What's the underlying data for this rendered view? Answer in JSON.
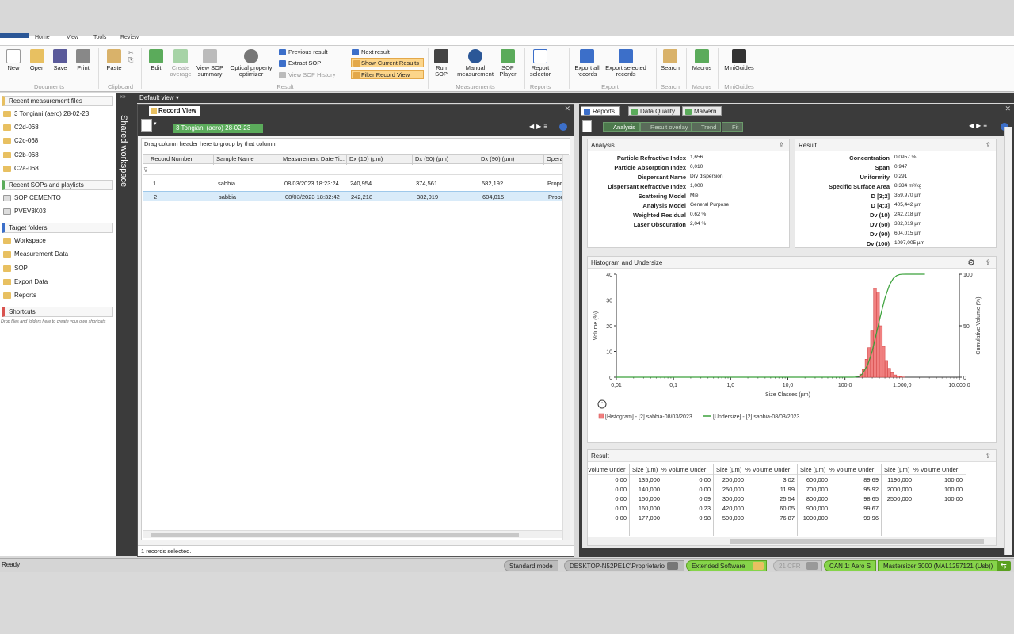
{
  "menu": [
    "Home",
    "View",
    "Tools",
    "Review"
  ],
  "ribbon": {
    "documents": {
      "label": "Documents",
      "buttons": [
        "New",
        "Open",
        "Save",
        "Print"
      ]
    },
    "clipboard": {
      "label": "Clipboard",
      "buttons": [
        "Paste"
      ]
    },
    "result": {
      "label": "Result",
      "edit": "Edit",
      "create_average": "Create average",
      "view_sop_summary": "View SOP summary",
      "optical_property": "Optical property optimizer",
      "previous_result": "Previous result",
      "extract_sop": "Extract SOP",
      "view_sop_history": "View SOP History",
      "next_result": "Next result",
      "show_current": "Show Current Results",
      "filter_record": "Filter Record View"
    },
    "measurements": {
      "label": "Measurements",
      "run_sop": "Run SOP",
      "manual": "Manual measurement",
      "sop_player": "SOP Player"
    },
    "reports": {
      "label": "Reports",
      "report_selector": "Report selector"
    },
    "export": {
      "label": "Export",
      "export_all": "Export all records",
      "export_selected": "Export selected records"
    },
    "search": {
      "label": "Search",
      "search": "Search"
    },
    "macros": {
      "label": "Macros",
      "macros": "Macros"
    },
    "miniguides": {
      "label": "MiniGuides",
      "miniguides": "MiniGuides"
    }
  },
  "left": {
    "recent_files_header": "Recent measurement files",
    "recent_files": [
      "3 Tongiani (aero) 28-02-23",
      "C2d-068",
      "C2c-068",
      "C2b-068",
      "C2a-068"
    ],
    "recent_sops_header": "Recent SOPs and playlists",
    "recent_sops": [
      "SOP CEMENTO",
      "PVEV3K03"
    ],
    "target_header": "Target folders",
    "target_folders": [
      "Workspace",
      "Measurement Data",
      "SOP",
      "Export Data",
      "Reports"
    ],
    "shortcuts_header": "Shortcuts",
    "shortcuts_hint": "Drop files and folders here to create your own shortcuts"
  },
  "shared_workspace": "Shared workspace",
  "default_view": "Default view",
  "record_view": {
    "tab": "Record View",
    "file": "3 Tongiani (aero) 28-02-23",
    "group_hint": "Drag column header here to group by that column",
    "columns": [
      "Record Number",
      "Sample Name",
      "Measurement Date Ti...",
      "Dx (10) (µm)",
      "Dx (50) (µm)",
      "Dx (90) (µm)",
      "Operato"
    ],
    "rows": [
      [
        "1",
        "sabbia",
        "08/03/2023 18:23:24",
        "240,954",
        "374,561",
        "582,192",
        "Proprie"
      ],
      [
        "2",
        "sabbia",
        "08/03/2023 18:32:42",
        "242,218",
        "382,019",
        "604,015",
        "Proprie"
      ]
    ],
    "footer": "1 records selected."
  },
  "right": {
    "tabs": [
      "Reports",
      "Data Quality",
      "Malvern"
    ],
    "subtabs": [
      "Analysis",
      "Result overlay",
      "Trend",
      "Fit"
    ],
    "analysis": {
      "title": "Analysis",
      "items": [
        {
          "k": "Particle Refractive Index",
          "v": "1,656"
        },
        {
          "k": "Particle Absorption Index",
          "v": "0,010"
        },
        {
          "k": "Dispersant Name",
          "v": "Dry dispersion"
        },
        {
          "k": "Dispersant Refractive Index",
          "v": "1,000"
        },
        {
          "k": "Scattering Model",
          "v": "Mie"
        },
        {
          "k": "Analysis Model",
          "v": "General Purpose"
        },
        {
          "k": "Weighted Residual",
          "v": "0,62 %"
        },
        {
          "k": "Laser Obscuration",
          "v": "2,04 %"
        }
      ]
    },
    "result": {
      "title": "Result",
      "items": [
        {
          "k": "Concentration",
          "v": "0,0957 %"
        },
        {
          "k": "Span",
          "v": "0,947"
        },
        {
          "k": "Uniformity",
          "v": "0,291"
        },
        {
          "k": "Specific Surface Area",
          "v": "8,334 m²/kg"
        },
        {
          "k": "D [3;2]",
          "v": "359,970 µm"
        },
        {
          "k": "D [4;3]",
          "v": "405,442 µm"
        },
        {
          "k": "Dv (10)",
          "v": "242,218 µm"
        },
        {
          "k": "Dv (50)",
          "v": "382,019 µm"
        },
        {
          "k": "Dv (90)",
          "v": "604,015 µm"
        },
        {
          "k": "Dv (100)",
          "v": "1097,005 µm"
        }
      ]
    },
    "histogram_title": "Histogram and Undersize",
    "result_table": {
      "title": "Result",
      "groups": [
        {
          "size_header": "",
          "vol_header": "Volume Under",
          "sizes": [
            "",
            "",
            "",
            "",
            ""
          ],
          "vols": [
            "0,00",
            "0,00",
            "0,00",
            "0,00",
            "0,00"
          ]
        },
        {
          "size_header": "Size (µm)",
          "vol_header": "% Volume Under",
          "sizes": [
            "135,000",
            "140,000",
            "150,000",
            "160,000",
            "177,000"
          ],
          "vols": [
            "0,00",
            "0,00",
            "0,09",
            "0,23",
            "0,98"
          ]
        },
        {
          "size_header": "Size (µm)",
          "vol_header": "% Volume Under",
          "sizes": [
            "200,000",
            "250,000",
            "300,000",
            "420,000",
            "500,000"
          ],
          "vols": [
            "3,02",
            "11,99",
            "25,54",
            "60,05",
            "76,87"
          ]
        },
        {
          "size_header": "Size (µm)",
          "vol_header": "% Volume Under",
          "sizes": [
            "600,000",
            "700,000",
            "800,000",
            "900,000",
            "1000,000"
          ],
          "vols": [
            "89,69",
            "95,92",
            "98,65",
            "99,67",
            "99,96"
          ]
        },
        {
          "size_header": "Size (µm)",
          "vol_header": "% Volume Under",
          "sizes": [
            "1190,000",
            "2000,000",
            "2500,000",
            "",
            ""
          ],
          "vols": [
            "100,00",
            "100,00",
            "100,00",
            "",
            ""
          ]
        }
      ]
    }
  },
  "chart_data": {
    "type": "bar",
    "xlabel": "Size Classes (µm)",
    "ylabel": "Volume (%)",
    "y2label": "Cumulative Volume (%)",
    "xscale": "log",
    "xlim": [
      0.01,
      10000
    ],
    "ylim": [
      0,
      40
    ],
    "y2lim": [
      0,
      100
    ],
    "xticks": [
      "0,01",
      "0,1",
      "1,0",
      "10,0",
      "100,0",
      "1.000,0",
      "10.000,0"
    ],
    "yticks": [
      "0",
      "10",
      "20",
      "30",
      "40"
    ],
    "y2ticks": [
      "0",
      "50",
      "100"
    ],
    "series": [
      {
        "name": "[Histogram] - [2] sabbia-08/03/2023",
        "kind": "bar",
        "color": "#f08080",
        "x_edges": [
          180,
          200,
          225,
          250,
          280,
          315,
          355,
          400,
          450,
          500,
          560,
          630,
          710,
          800,
          900,
          1000,
          1100
        ],
        "values": [
          1.2,
          3.0,
          7.0,
          11.5,
          18.0,
          34.5,
          33.0,
          20.0,
          12.0,
          6.5,
          3.5,
          1.8,
          0.9,
          0.4,
          0.2,
          0.1
        ]
      },
      {
        "name": "[Undersize] - [2] sabbia-08/03/2023",
        "kind": "line",
        "color": "#3aa13a",
        "x": [
          0.01,
          100,
          135,
          150,
          177,
          200,
          250,
          300,
          420,
          500,
          600,
          700,
          800,
          900,
          1000,
          1190,
          2500
        ],
        "y": [
          0,
          0,
          0,
          0.09,
          0.98,
          3.02,
          11.99,
          25.54,
          60.05,
          76.87,
          89.69,
          95.92,
          98.65,
          99.67,
          99.96,
          100,
          100
        ]
      }
    ]
  },
  "status": {
    "ready": "Ready",
    "mode": "Standard mode",
    "user": "DESKTOP-N52PE1C\\Proprietario",
    "software": "Extended Software",
    "cfr": "21 CFR",
    "can": "CAN 1: Aero S",
    "instrument": "Mastersizer 3000 (MAL1257121 (Usb))"
  },
  "colors": {
    "accent_green": "#5bab5b",
    "highlight": "#fcd58a",
    "dark": "#3b3b3b"
  }
}
